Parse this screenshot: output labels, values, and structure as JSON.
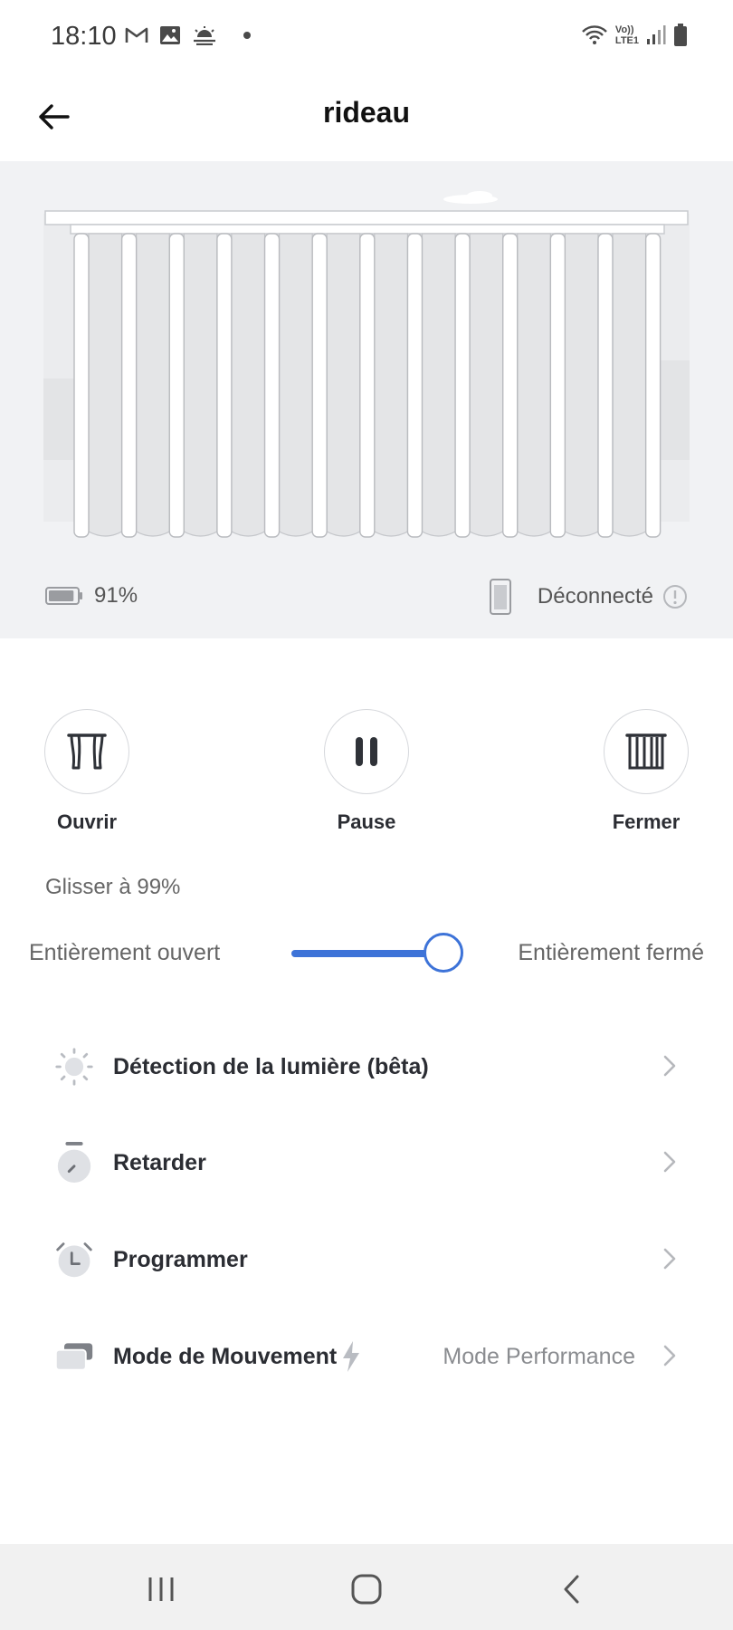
{
  "status_bar": {
    "time": "18:10",
    "left_icons": [
      "gmail-icon",
      "image-icon",
      "weather-icon",
      "dot-icon"
    ],
    "right_icons": [
      "wifi-icon",
      "volte-icon",
      "signal-icon",
      "battery-icon"
    ],
    "volte_text_top": "Vo))",
    "volte_text_bottom": "LTE1"
  },
  "header": {
    "title": "rideau",
    "back_icon": "arrow-left-icon"
  },
  "device": {
    "battery_percent": "91%",
    "battery_level": 0.91,
    "connection_status": "Déconnecté",
    "curtain_closed_fraction": 0.99
  },
  "controls": {
    "open_label": "Ouvrir",
    "pause_label": "Pause",
    "close_label": "Fermer"
  },
  "slider": {
    "label": "Glisser à 99%",
    "left_label": "Entièrement ouvert",
    "right_label": "Entièrement fermé",
    "value_percent": 99,
    "accent": "#3d73d8"
  },
  "menu": [
    {
      "icon": "sun-icon",
      "label": "Détection de la lumière (bêta)",
      "value": ""
    },
    {
      "icon": "stopwatch-icon",
      "label": "Retarder",
      "value": ""
    },
    {
      "icon": "alarm-clock-icon",
      "label": "Programmer",
      "value": ""
    },
    {
      "icon": "motion-mode-icon",
      "label": "Mode de Mouvement",
      "value": "Mode Performance"
    }
  ],
  "nav": {
    "recents_icon": "recents-icon",
    "home_icon": "home-icon",
    "back_icon": "back-chevron-icon"
  }
}
